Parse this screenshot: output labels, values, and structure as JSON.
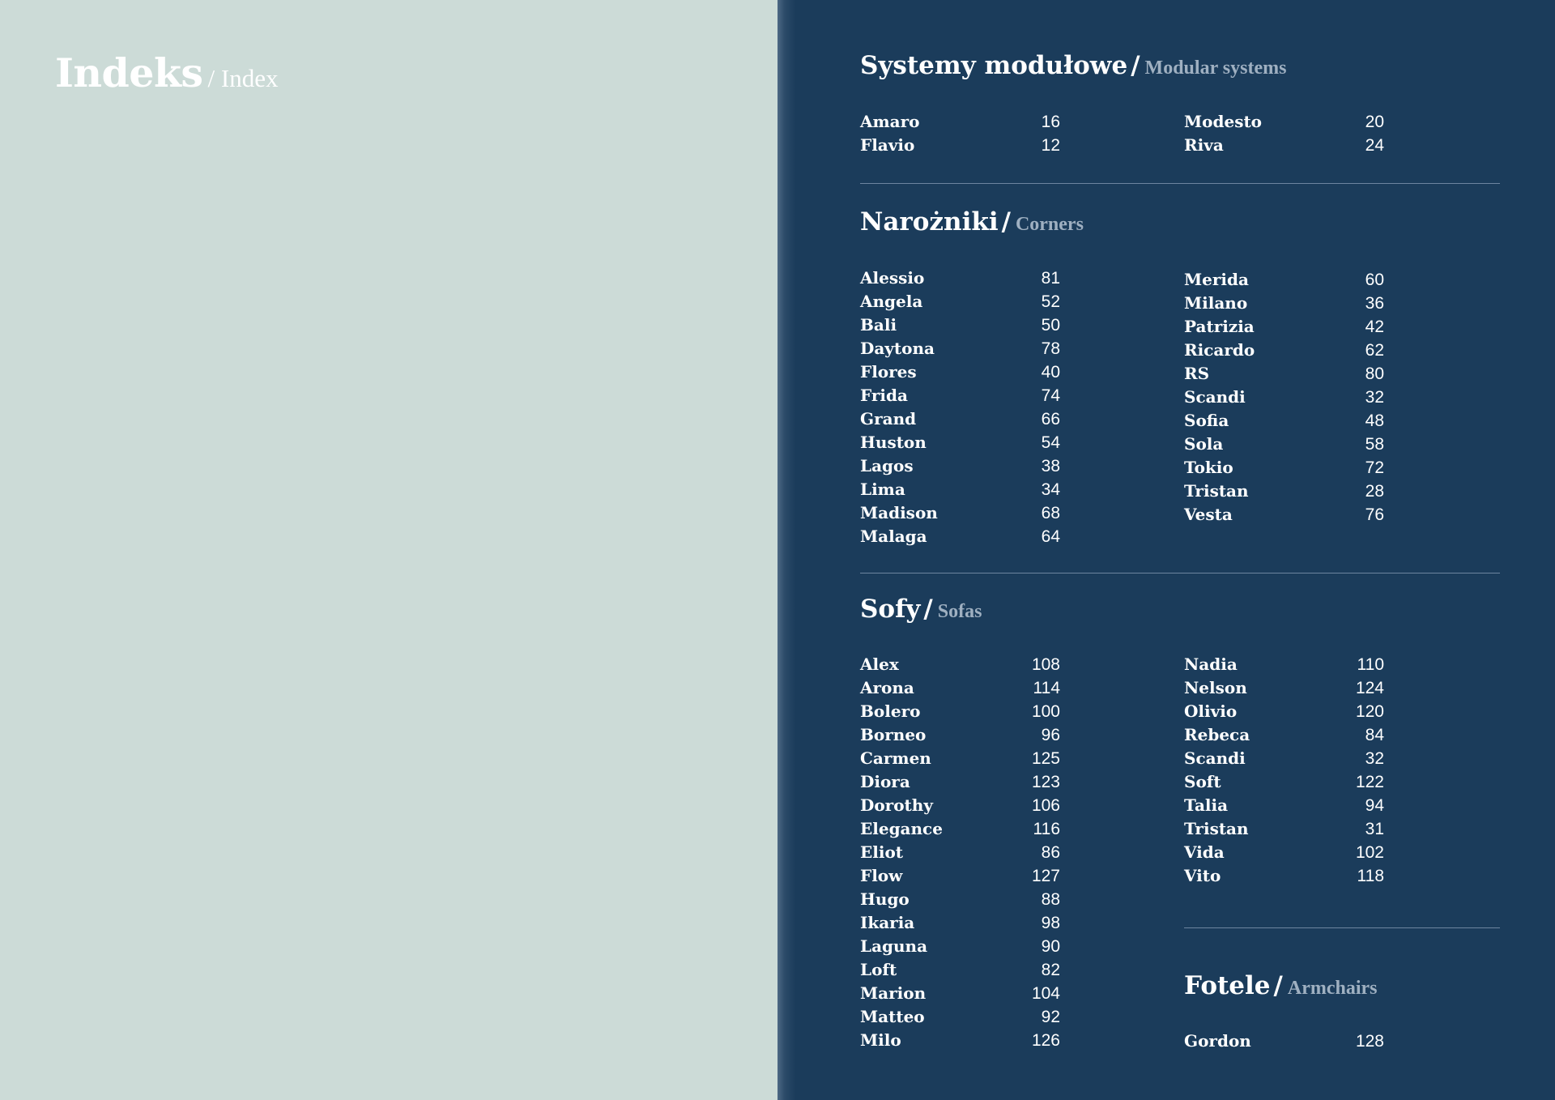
{
  "page_title": {
    "pl": "Indeks",
    "en": "/ Index"
  },
  "sections": {
    "modular": {
      "pl": "Systemy modułowe",
      "en": "Modular systems",
      "col1": [
        {
          "name": "Amaro",
          "page": "16"
        },
        {
          "name": "Flavio",
          "page": "12"
        }
      ],
      "col2": [
        {
          "name": "Modesto",
          "page": "20"
        },
        {
          "name": "Riva",
          "page": "24"
        }
      ]
    },
    "corners": {
      "pl": "Narożniki",
      "en": "Corners",
      "col1": [
        {
          "name": "Alessio",
          "page": "81"
        },
        {
          "name": "Angela",
          "page": "52"
        },
        {
          "name": "Bali",
          "page": "50"
        },
        {
          "name": "Daytona",
          "page": "78"
        },
        {
          "name": "Flores",
          "page": "40"
        },
        {
          "name": "Frida",
          "page": "74"
        },
        {
          "name": "Grand",
          "page": "66"
        },
        {
          "name": "Huston",
          "page": "54"
        },
        {
          "name": "Lagos",
          "page": "38"
        },
        {
          "name": "Lima",
          "page": "34"
        },
        {
          "name": "Madison",
          "page": "68"
        },
        {
          "name": "Malaga",
          "page": "64"
        }
      ],
      "col2": [
        {
          "name": "Merida",
          "page": "60"
        },
        {
          "name": "Milano",
          "page": "36"
        },
        {
          "name": "Patrizia",
          "page": "42"
        },
        {
          "name": "Ricardo",
          "page": "62"
        },
        {
          "name": "RS",
          "page": "80"
        },
        {
          "name": "Scandi",
          "page": "32"
        },
        {
          "name": "Sofia",
          "page": "48"
        },
        {
          "name": "Sola",
          "page": "58"
        },
        {
          "name": "Tokio",
          "page": "72"
        },
        {
          "name": "Tristan",
          "page": "28"
        },
        {
          "name": "Vesta",
          "page": "76"
        }
      ]
    },
    "sofas": {
      "pl": "Sofy",
      "en": "Sofas",
      "col1": [
        {
          "name": "Alex",
          "page": "108"
        },
        {
          "name": "Arona",
          "page": "114"
        },
        {
          "name": "Bolero",
          "page": "100"
        },
        {
          "name": "Borneo",
          "page": "96"
        },
        {
          "name": "Carmen",
          "page": "125"
        },
        {
          "name": "Diora",
          "page": "123"
        },
        {
          "name": "Dorothy",
          "page": "106"
        },
        {
          "name": "Elegance",
          "page": "116"
        },
        {
          "name": "Eliot",
          "page": "86"
        },
        {
          "name": "Flow",
          "page": "127"
        },
        {
          "name": "Hugo",
          "page": "88"
        },
        {
          "name": "Ikaria",
          "page": "98"
        },
        {
          "name": "Laguna",
          "page": "90"
        },
        {
          "name": "Loft",
          "page": "82"
        },
        {
          "name": "Marion",
          "page": "104"
        },
        {
          "name": "Matteo",
          "page": "92"
        },
        {
          "name": "Milo",
          "page": "126"
        }
      ],
      "col2": [
        {
          "name": "Nadia",
          "page": "110"
        },
        {
          "name": "Nelson",
          "page": "124"
        },
        {
          "name": "Olivio",
          "page": "120"
        },
        {
          "name": "Rebeca",
          "page": "84"
        },
        {
          "name": "Scandi",
          "page": "32"
        },
        {
          "name": "Soft",
          "page": "122"
        },
        {
          "name": "Talia",
          "page": "94"
        },
        {
          "name": "Tristan",
          "page": "31"
        },
        {
          "name": "Vida",
          "page": "102"
        },
        {
          "name": "Vito",
          "page": "118"
        }
      ]
    },
    "armchairs": {
      "pl": "Fotele",
      "en": "Armchairs",
      "col1": [
        {
          "name": "Gordon",
          "page": "128"
        }
      ]
    }
  }
}
